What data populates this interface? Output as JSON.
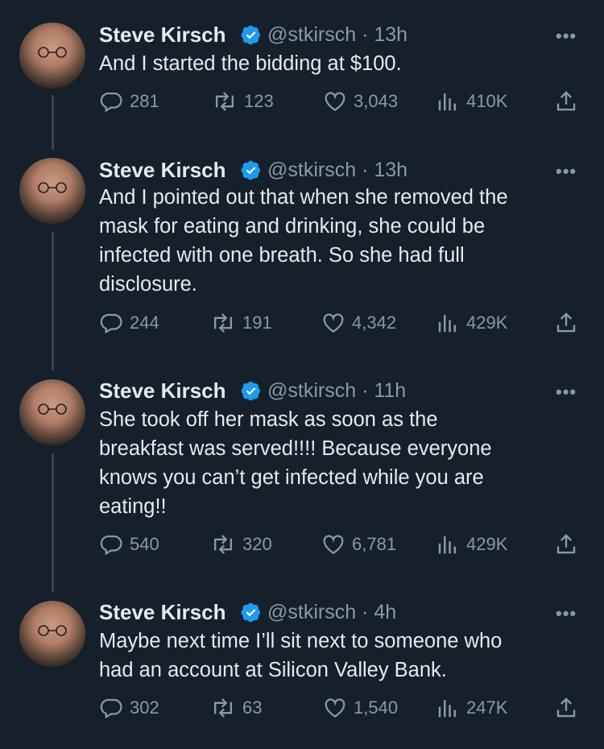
{
  "author": {
    "name": "Steve Kirsch",
    "handle": "@stkirsch"
  },
  "icons": {
    "verified": "verified-badge-icon",
    "reply": "reply-icon",
    "retweet": "retweet-icon",
    "like": "heart-icon",
    "views": "views-icon",
    "share": "share-icon",
    "more": "more-icon"
  },
  "colors": {
    "background": "#15202b",
    "text": "#e7e9ea",
    "muted": "#8b98a5",
    "verified": "#1d9bf0",
    "thread_line": "#38444d"
  },
  "tweets": [
    {
      "time": "· 13h",
      "text": "And I started the bidding at $100.",
      "replies": "281",
      "retweets": "123",
      "likes": "3,043",
      "views": "410K"
    },
    {
      "time": "· 13h",
      "text": "And I pointed out that when she removed the\nmask for eating and drinking, she could be\ninfected with one breath. So she had full\ndisclosure.",
      "replies": "244",
      "retweets": "191",
      "likes": "4,342",
      "views": "429K"
    },
    {
      "time": "· 11h",
      "text": "She took off her mask as soon as the\nbreakfast was served!!!! Because everyone\nknows you can’t get infected while you are\neating!!",
      "replies": "540",
      "retweets": "320",
      "likes": "6,781",
      "views": "429K"
    },
    {
      "time": "· 4h",
      "text": "Maybe next time I’ll sit next to someone who\nhad an account at Silicon Valley Bank.",
      "replies": "302",
      "retweets": "63",
      "likes": "1,540",
      "views": "247K"
    }
  ]
}
